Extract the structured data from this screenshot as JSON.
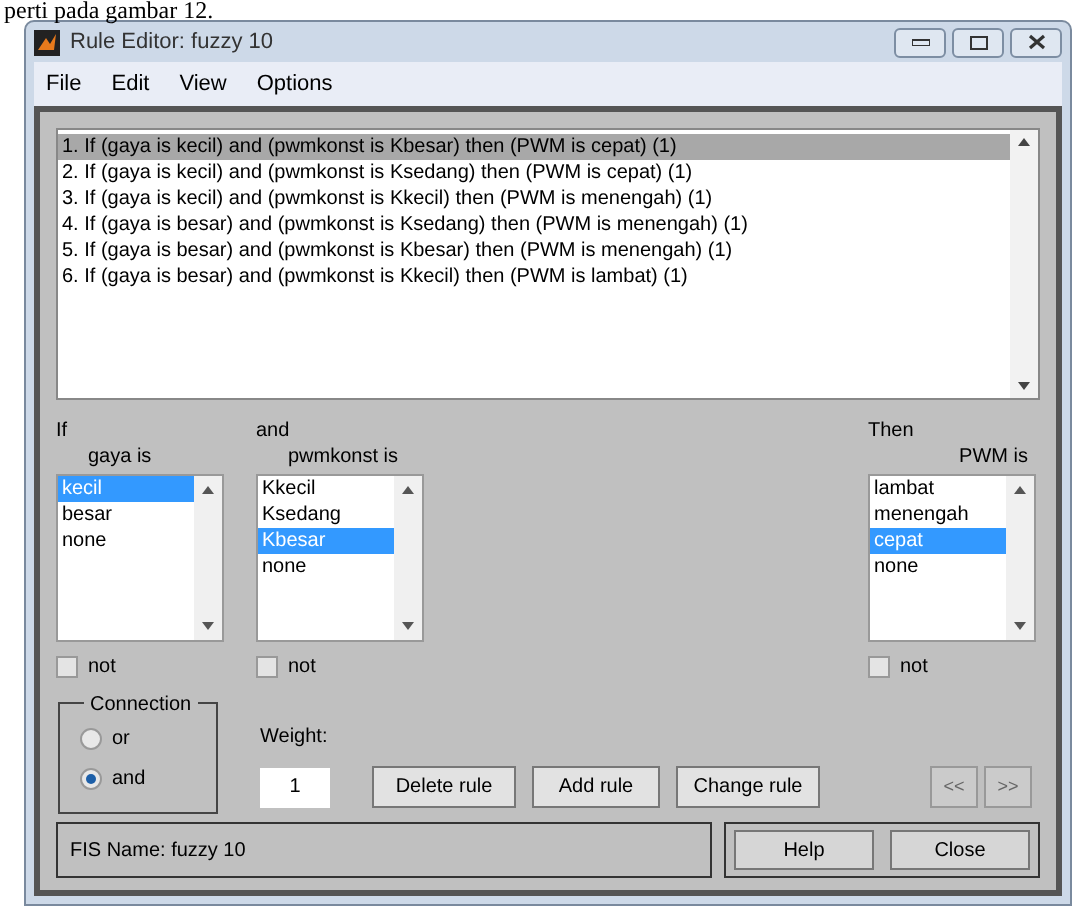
{
  "doc_text": "perti pada gambar 12.",
  "window": {
    "title": "Rule Editor: fuzzy 10"
  },
  "menu": [
    "File",
    "Edit",
    "View",
    "Options"
  ],
  "rules": [
    {
      "text": "1. If (gaya is kecil) and (pwmkonst is Kbesar) then (PWM is cepat) (1)",
      "selected": true
    },
    {
      "text": "2. If (gaya is kecil) and (pwmkonst is Ksedang) then (PWM is cepat) (1)",
      "selected": false
    },
    {
      "text": "3. If (gaya is kecil) and (pwmkonst is Kkecil) then (PWM is menengah) (1)",
      "selected": false
    },
    {
      "text": "4. If (gaya is besar) and (pwmkonst is Ksedang) then (PWM is menengah) (1)",
      "selected": false
    },
    {
      "text": "5. If (gaya is besar) and (pwmkonst is Kbesar) then (PWM is menengah) (1)",
      "selected": false
    },
    {
      "text": "6. If (gaya is besar) and (pwmkonst is Kkecil) then (PWM is lambat) (1)",
      "selected": false
    }
  ],
  "inputs": [
    {
      "prefix": "If",
      "label": "gaya is",
      "not_label": "not",
      "not": false,
      "options": [
        {
          "label": "kecil",
          "selected": true
        },
        {
          "label": "besar",
          "selected": false
        },
        {
          "label": "none",
          "selected": false
        }
      ]
    },
    {
      "prefix": "and",
      "label": "pwmkonst is",
      "not_label": "not",
      "not": false,
      "options": [
        {
          "label": "Kkecil",
          "selected": false
        },
        {
          "label": "Ksedang",
          "selected": false
        },
        {
          "label": "Kbesar",
          "selected": true
        },
        {
          "label": "none",
          "selected": false
        }
      ]
    }
  ],
  "output": {
    "prefix": "Then",
    "label": "PWM is",
    "not_label": "not",
    "not": false,
    "options": [
      {
        "label": "lambat",
        "selected": false
      },
      {
        "label": "menengah",
        "selected": false
      },
      {
        "label": "cepat",
        "selected": true
      },
      {
        "label": "none",
        "selected": false
      }
    ]
  },
  "connection": {
    "title": "Connection",
    "options": [
      {
        "label": "or",
        "selected": false
      },
      {
        "label": "and",
        "selected": true
      }
    ]
  },
  "weight": {
    "label": "Weight:",
    "value": "1"
  },
  "buttons": [
    "Delete rule",
    "Add rule",
    "Change rule"
  ],
  "nav_buttons": [
    {
      "label": "<<",
      "disabled": true
    },
    {
      "label": ">>",
      "disabled": true
    }
  ],
  "status": "FIS Name: fuzzy 10",
  "footer_buttons": [
    "Help",
    "Close"
  ]
}
